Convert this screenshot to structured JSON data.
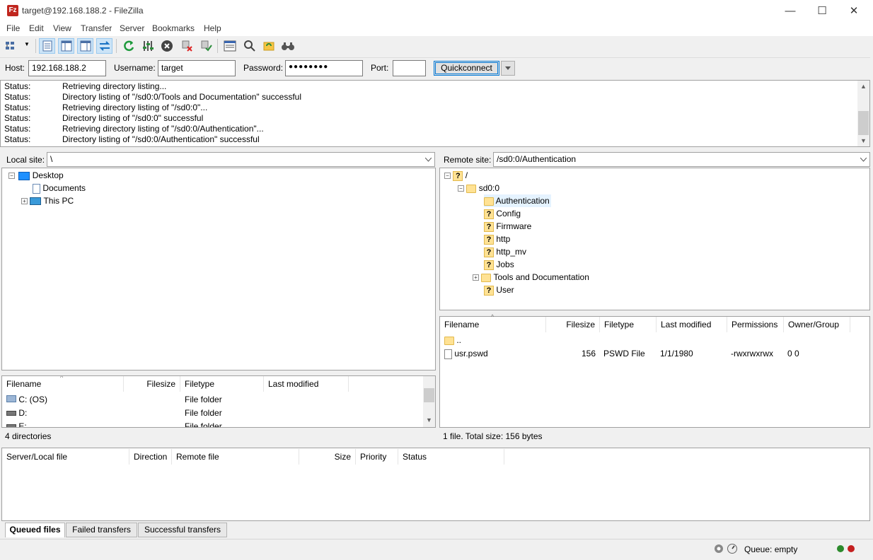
{
  "window": {
    "title": "target@192.168.188.2 - FileZilla",
    "app_icon_text": "Fz",
    "minimize": "—",
    "maximize": "☐",
    "close": "✕"
  },
  "menu": [
    "File",
    "Edit",
    "View",
    "Transfer",
    "Server",
    "Bookmarks",
    "Help"
  ],
  "quickconnect": {
    "host_label": "Host:",
    "host_value": "192.168.188.2",
    "username_label": "Username:",
    "username_value": "target",
    "password_label": "Password:",
    "password_value": "●●●●●●●●",
    "port_label": "Port:",
    "port_value": "",
    "button_label": "Quickconnect"
  },
  "log": [
    {
      "kind": "Status:",
      "text": "Retrieving directory listing..."
    },
    {
      "kind": "Status:",
      "text": "Directory listing of \"/sd0:0/Tools and Documentation\" successful"
    },
    {
      "kind": "Status:",
      "text": "Retrieving directory listing of \"/sd0:0\"..."
    },
    {
      "kind": "Status:",
      "text": "Directory listing of \"/sd0:0\" successful"
    },
    {
      "kind": "Status:",
      "text": "Retrieving directory listing of \"/sd0:0/Authentication\"..."
    },
    {
      "kind": "Status:",
      "text": "Directory listing of \"/sd0:0/Authentication\" successful"
    }
  ],
  "local": {
    "site_label": "Local site:",
    "site_path": "\\",
    "tree": [
      {
        "label": "Desktop",
        "expander": "−",
        "icon": "desktop-icon"
      },
      {
        "label": "Documents",
        "icon": "documents-icon"
      },
      {
        "label": "This PC",
        "expander": "+",
        "icon": "computer-icon"
      }
    ],
    "columns": [
      "Filename",
      "Filesize",
      "Filetype",
      "Last modified"
    ],
    "files": [
      {
        "name": "C: (OS)",
        "type": "File folder",
        "icon": "drive-os-icon"
      },
      {
        "name": "D:",
        "type": "File folder",
        "icon": "drive-icon"
      },
      {
        "name": "E:",
        "type": "File folder",
        "icon": "drive-icon"
      }
    ],
    "status": "4 directories"
  },
  "remote": {
    "site_label": "Remote site:",
    "site_path": "/sd0:0/Authentication",
    "tree": [
      {
        "label": "/",
        "icon": "unknown-folder-icon"
      },
      {
        "label": "sd0:0",
        "icon": "folder-icon"
      },
      {
        "label": "Authentication",
        "icon": "folder-icon",
        "selected": true
      },
      {
        "label": "Config",
        "icon": "unknown-folder-icon"
      },
      {
        "label": "Firmware",
        "icon": "unknown-folder-icon"
      },
      {
        "label": "http",
        "icon": "unknown-folder-icon"
      },
      {
        "label": "http_mv",
        "icon": "unknown-folder-icon"
      },
      {
        "label": "Jobs",
        "icon": "unknown-folder-icon"
      },
      {
        "label": "Tools and Documentation",
        "icon": "folder-icon"
      },
      {
        "label": "User",
        "icon": "unknown-folder-icon"
      }
    ],
    "columns": [
      "Filename",
      "Filesize",
      "Filetype",
      "Last modified",
      "Permissions",
      "Owner/Group"
    ],
    "files": [
      {
        "name": "..",
        "size": "",
        "type": "",
        "modified": "",
        "perms": "",
        "owner": ""
      },
      {
        "name": "usr.pswd",
        "size": "156",
        "type": "PSWD File",
        "modified": "1/1/1980",
        "perms": "-rwxrwxrwx",
        "owner": "0 0"
      }
    ],
    "status": "1 file. Total size: 156 bytes"
  },
  "queue": {
    "columns": [
      "Server/Local file",
      "Direction",
      "Remote file",
      "Size",
      "Priority",
      "Status"
    ],
    "tabs": [
      "Queued files",
      "Failed transfers",
      "Successful transfers"
    ]
  },
  "statusbar": {
    "queue_text": "Queue: empty"
  }
}
